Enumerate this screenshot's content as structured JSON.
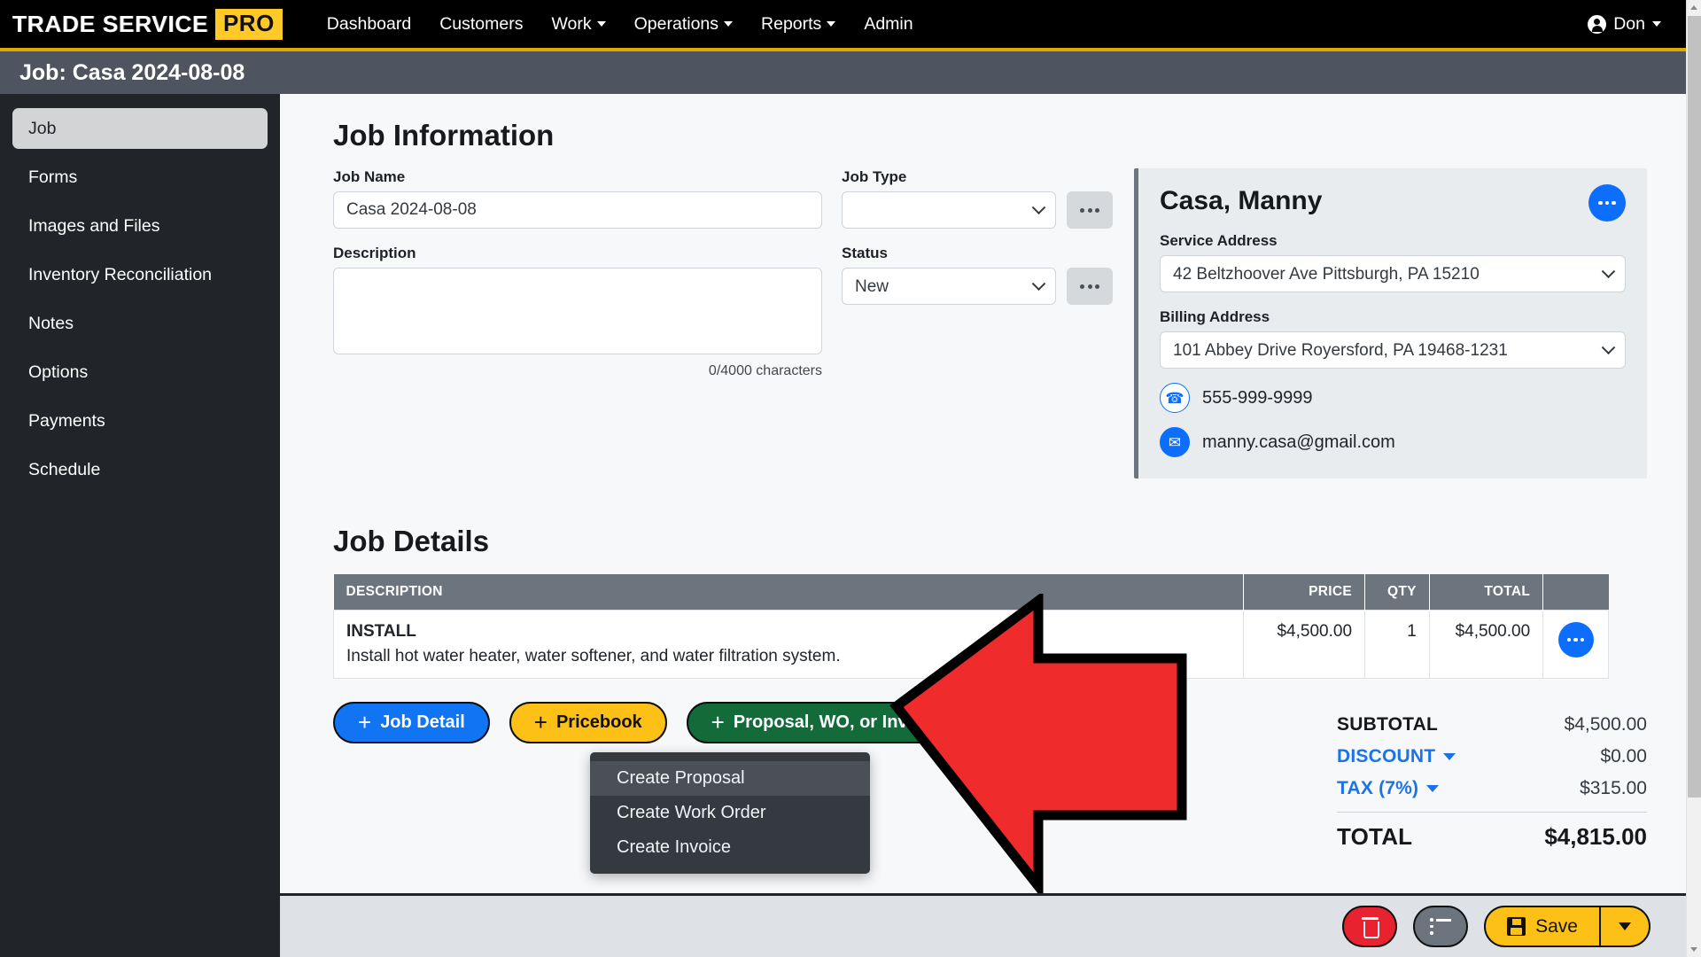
{
  "navbar": {
    "logo_main": "TRADE SERVICE",
    "logo_badge": "PRO",
    "items": [
      {
        "label": "Dashboard",
        "has_caret": false
      },
      {
        "label": "Customers",
        "has_caret": false
      },
      {
        "label": "Work",
        "has_caret": true
      },
      {
        "label": "Operations",
        "has_caret": true
      },
      {
        "label": "Reports",
        "has_caret": true
      },
      {
        "label": "Admin",
        "has_caret": false
      }
    ],
    "user": "Don"
  },
  "page": {
    "title": "Job: Casa 2024-08-08"
  },
  "sidebar": {
    "items": [
      {
        "label": "Job",
        "active": true
      },
      {
        "label": "Forms",
        "active": false
      },
      {
        "label": "Images and Files",
        "active": false
      },
      {
        "label": "Inventory Reconciliation",
        "active": false
      },
      {
        "label": "Notes",
        "active": false
      },
      {
        "label": "Options",
        "active": false
      },
      {
        "label": "Payments",
        "active": false
      },
      {
        "label": "Schedule",
        "active": false
      }
    ]
  },
  "job_information": {
    "heading": "Job Information",
    "job_name": {
      "label": "Job Name",
      "value": "Casa 2024-08-08",
      "placeholder": ""
    },
    "description": {
      "label": "Description",
      "value": "",
      "placeholder": "",
      "char_count": "0/4000 characters"
    },
    "job_type": {
      "label": "Job Type",
      "value": "",
      "options": [
        ""
      ]
    },
    "status": {
      "label": "Status",
      "value": "New",
      "options": [
        "New"
      ]
    },
    "ellipsis_label": "..."
  },
  "customer": {
    "name": "Casa, Manny",
    "service_address": {
      "label": "Service Address",
      "value": "42 Beltzhoover Ave Pittsburgh, PA 15210"
    },
    "billing_address": {
      "label": "Billing Address",
      "value": "101 Abbey Drive Royersford, PA 19468-1231"
    },
    "phone": "555-999-9999",
    "email": "manny.casa@gmail.com",
    "phone_icon": "phone-icon",
    "email_icon": "envelope-icon",
    "more_icon": "ellipsis-icon"
  },
  "job_details": {
    "heading": "Job Details",
    "columns": [
      "DESCRIPTION",
      "PRICE",
      "QTY",
      "TOTAL",
      ""
    ],
    "rows": [
      {
        "title": "INSTALL",
        "description": "Install hot water heater, water softener, and water filtration system.",
        "price": "$4,500.00",
        "qty": "1",
        "total": "$4,500.00"
      }
    ]
  },
  "actions": {
    "job_detail": "Job Detail",
    "pricebook": "Pricebook",
    "proposal_wo_invoice": "Proposal, WO, or Invoice",
    "plus": "+"
  },
  "dropdown": {
    "open": true,
    "items": [
      {
        "label": "Create Proposal",
        "highlighted": true
      },
      {
        "label": "Create Work Order",
        "highlighted": false
      },
      {
        "label": "Create Invoice",
        "highlighted": false
      }
    ]
  },
  "totals": {
    "subtotal_label": "SUBTOTAL",
    "subtotal_value": "$4,500.00",
    "discount_label": "DISCOUNT",
    "discount_value": "$0.00",
    "tax_label": "TAX (7%)",
    "tax_value": "$315.00",
    "total_label": "TOTAL",
    "total_value": "$4,815.00"
  },
  "footer": {
    "delete_icon": "trash-icon",
    "list_icon": "list-icon",
    "save_label": "Save",
    "save_icon": "floppy-disk-icon"
  },
  "annotation": {
    "type": "red-left-arrow",
    "color": "#ef2b2b",
    "outline": "#000000",
    "points_to": "Create Proposal"
  },
  "colors": {
    "navbar_bg": "#000000",
    "navbar_accent": "#e0a800",
    "titlebar_bg": "#4e5560",
    "sidebar_bg": "#212529",
    "sidebar_active_bg": "#d3d4d5",
    "page_bg": "#f7f8fa",
    "table_header_bg": "#6c757d",
    "primary_blue": "#0d6efd",
    "link_blue": "#1a73e8",
    "green": "#136b3a",
    "yellow": "#fcc017",
    "red": "#e8232f",
    "card_bg": "#e9ecef",
    "footer_bg": "#dee2e6"
  }
}
